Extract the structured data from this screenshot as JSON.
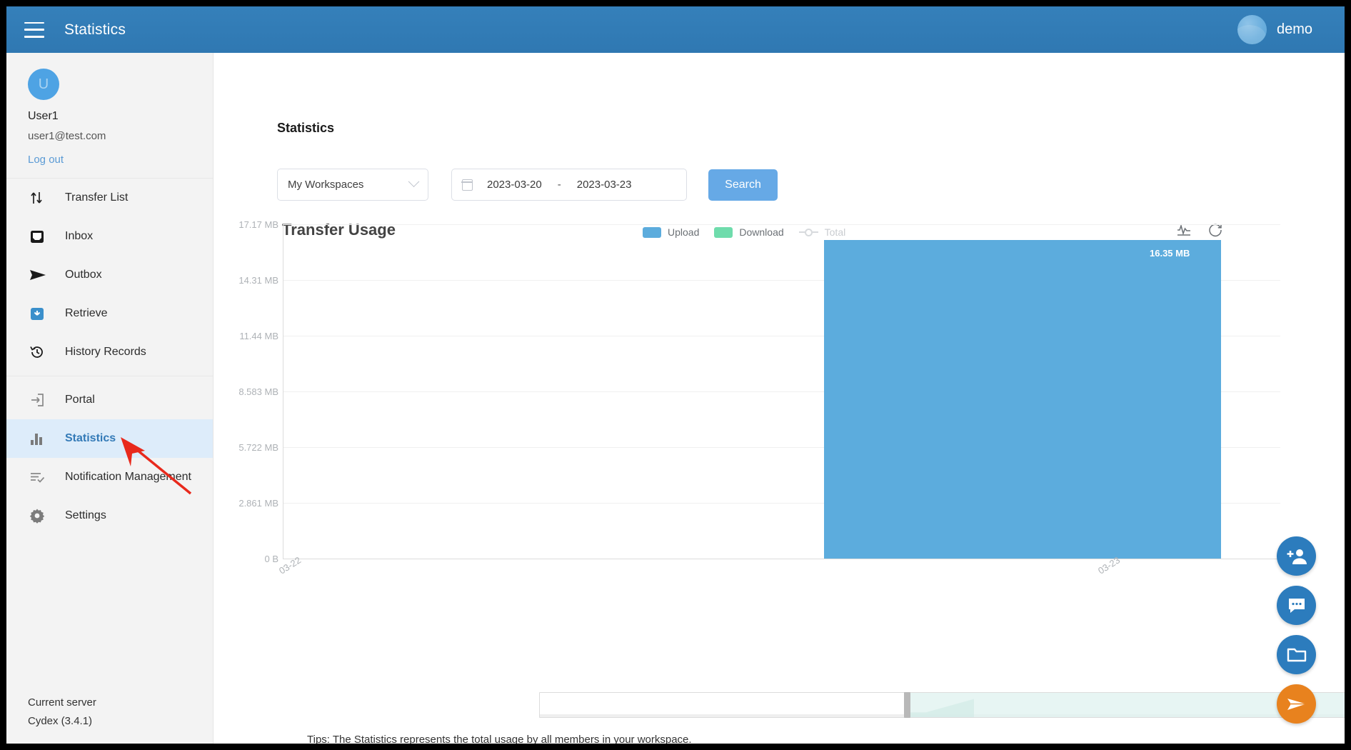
{
  "topbar": {
    "menu_icon": "hamburger-icon",
    "title": "Statistics",
    "user": "demo"
  },
  "sidebar": {
    "avatar_initial": "U",
    "user_name": "User1",
    "user_email": "user1@test.com",
    "logout": "Log out",
    "items": [
      {
        "label": "Transfer List",
        "icon": "transfer-arrows-icon",
        "active": false
      },
      {
        "label": "Inbox",
        "icon": "inbox-icon",
        "active": false
      },
      {
        "label": "Outbox",
        "icon": "send-icon",
        "active": false
      },
      {
        "label": "Retrieve",
        "icon": "download-box-icon",
        "active": false
      },
      {
        "label": "History Records",
        "icon": "history-clock-icon",
        "active": false
      },
      {
        "label": "Portal",
        "icon": "portal-login-icon",
        "active": false
      },
      {
        "label": "Statistics",
        "icon": "bar-chart-icon",
        "active": true
      },
      {
        "label": "Notification Management",
        "icon": "notification-list-icon",
        "active": false
      },
      {
        "label": "Settings",
        "icon": "gear-icon",
        "active": false
      }
    ],
    "server_label": "Current server",
    "server_value": "Cydex (3.4.1)"
  },
  "main": {
    "page_title": "Statistics",
    "filters": {
      "workspace_selected": "My Workspaces",
      "date_start": "2023-03-20",
      "date_separator": "-",
      "date_end": "2023-03-23",
      "search_label": "Search"
    },
    "tips": "Tips: The Statistics represents the total usage by all members in your workspace.",
    "chart_tools": {
      "line_toggle_icon": "line-chart-toggle-icon",
      "restore_icon": "refresh-restore-icon"
    }
  },
  "fabs": [
    {
      "name": "add-user-fab",
      "icon": "add-user-icon",
      "color": "#2c7cbd"
    },
    {
      "name": "chat-fab",
      "icon": "chat-bubble-icon",
      "color": "#2c7cbd"
    },
    {
      "name": "folder-fab",
      "icon": "folder-icon",
      "color": "#2c7cbd"
    },
    {
      "name": "send-fab",
      "icon": "send-paper-plane-icon",
      "color": "#e8821e"
    }
  ],
  "colors": {
    "header_blue": "#337ab7",
    "upload_blue": "#5cacdd",
    "download_green": "#6fdcac",
    "accent_orange": "#e8821e",
    "active_nav_bg": "#ddecfa"
  },
  "chart_data": {
    "type": "bar",
    "title": "Transfer Usage",
    "xlabel": "",
    "ylabel": "",
    "categories": [
      "03-22",
      "03-23"
    ],
    "series": [
      {
        "name": "Upload",
        "values": [
          0,
          16.35
        ],
        "color": "#5cacdd",
        "unit": "MB"
      },
      {
        "name": "Download",
        "values": [
          0,
          0
        ],
        "color": "#6fdcac",
        "unit": "MB"
      },
      {
        "name": "Total",
        "values": [
          null,
          null
        ],
        "color": "#d7dadd",
        "disabled": true
      }
    ],
    "data_labels": [
      "",
      "16.35 MB"
    ],
    "ytick_labels": [
      "0 B",
      "2.861 MB",
      "5.722 MB",
      "8.583 MB",
      "11.44 MB",
      "14.31 MB",
      "17.17 MB"
    ],
    "ytick_values": [
      0,
      2.861,
      5.722,
      8.583,
      11.44,
      14.31,
      17.17
    ],
    "ylim": [
      0,
      17.17
    ],
    "grid": true,
    "legend_position": "top-center",
    "legend": [
      "Upload",
      "Download",
      "Total"
    ],
    "datazoom": {
      "start_percent": 44,
      "end_percent": 100
    }
  }
}
